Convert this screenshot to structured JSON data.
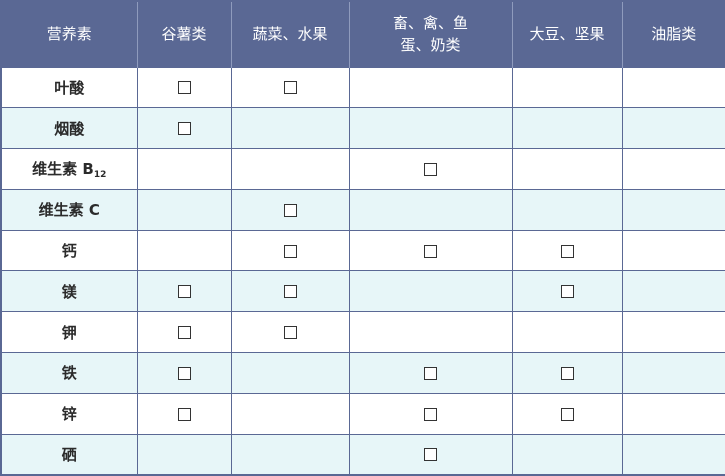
{
  "header": {
    "col0": "营养素",
    "col1": "谷薯类",
    "col2": "蔬菜、水果",
    "col3_line1": "畜、禽、鱼",
    "col3_line2": "蛋、奶类",
    "col4": "大豆、坚果",
    "col5": "油脂类"
  },
  "rows": [
    {
      "name": "叶酸",
      "cells": [
        true,
        true,
        false,
        false,
        false
      ]
    },
    {
      "name": "烟酸",
      "cells": [
        true,
        false,
        false,
        false,
        false
      ]
    },
    {
      "name": "维生素 B",
      "name_sub": "12",
      "cells": [
        false,
        false,
        true,
        false,
        false
      ]
    },
    {
      "name": "维生素 C",
      "cells": [
        false,
        true,
        false,
        false,
        false
      ]
    },
    {
      "name": "钙",
      "cells": [
        false,
        true,
        true,
        true,
        false
      ]
    },
    {
      "name": "镁",
      "cells": [
        true,
        true,
        false,
        true,
        false
      ]
    },
    {
      "name": "钾",
      "cells": [
        true,
        true,
        false,
        false,
        false
      ]
    },
    {
      "name": "铁",
      "cells": [
        true,
        false,
        true,
        true,
        false
      ]
    },
    {
      "name": "锌",
      "cells": [
        true,
        false,
        true,
        true,
        false
      ]
    },
    {
      "name": "硒",
      "cells": [
        false,
        false,
        true,
        false,
        false
      ]
    }
  ],
  "style": {
    "header_bg": "#5a6894",
    "alt_row_bg": "#e7f6f8",
    "border_color": "#5a6894"
  }
}
